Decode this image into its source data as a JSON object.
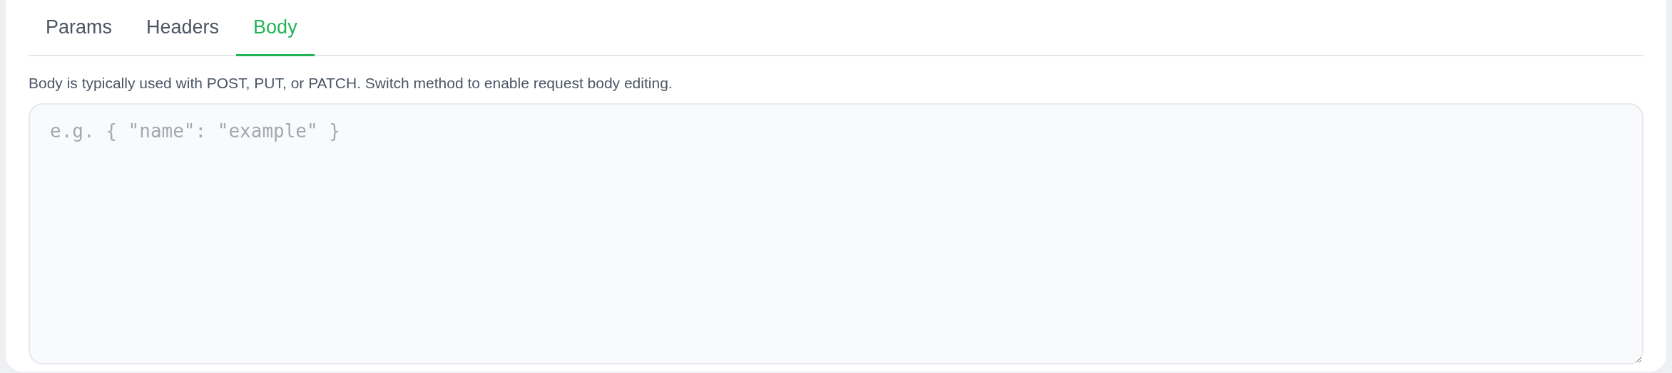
{
  "tabs": [
    {
      "label": "Params",
      "selected": false
    },
    {
      "label": "Headers",
      "selected": false
    },
    {
      "label": "Body",
      "selected": true
    }
  ],
  "body": {
    "hint": "Body is typically used with POST, PUT, or PATCH. Switch method to enable request body editing.",
    "placeholder": "e.g. { \"name\": \"example\" }",
    "disabled": false
  }
}
